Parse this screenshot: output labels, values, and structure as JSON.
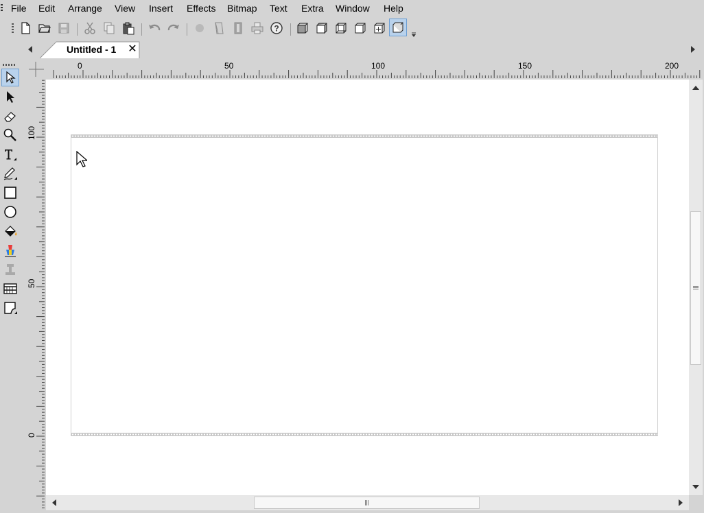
{
  "menu": {
    "items": [
      "File",
      "Edit",
      "Arrange",
      "View",
      "Insert",
      "Effects",
      "Bitmap",
      "Text",
      "Extra",
      "Window",
      "Help"
    ]
  },
  "toolbar": {
    "buttons": [
      {
        "icon": "new-document-icon",
        "enabled": true
      },
      {
        "icon": "open-folder-icon",
        "enabled": true
      },
      {
        "icon": "save-icon",
        "enabled": false
      },
      {
        "icon": "cut-icon",
        "enabled": false
      },
      {
        "icon": "copy-icon",
        "enabled": false
      },
      {
        "icon": "paste-icon",
        "enabled": true
      },
      {
        "icon": "undo-icon",
        "enabled": false
      },
      {
        "icon": "redo-icon",
        "enabled": false
      },
      {
        "icon": "circle-fill-icon",
        "enabled": false
      },
      {
        "icon": "page-curl-icon",
        "enabled": false
      },
      {
        "icon": "gradient-icon",
        "enabled": false
      },
      {
        "icon": "print-icon",
        "enabled": false
      },
      {
        "icon": "help-icon",
        "enabled": true
      },
      {
        "icon": "cube-front-icon",
        "enabled": true
      },
      {
        "icon": "cube-right-icon",
        "enabled": true
      },
      {
        "icon": "cube-wire-icon",
        "enabled": true
      },
      {
        "icon": "cube-left-icon",
        "enabled": true
      },
      {
        "icon": "cube-add-icon",
        "enabled": true
      },
      {
        "icon": "cube-3d-icon",
        "enabled": true,
        "active": true
      }
    ]
  },
  "tabs": [
    {
      "label": "Untitled - 1",
      "close_icon": "close-icon"
    }
  ],
  "rulers": {
    "horizontal_labels": [
      "0",
      "50",
      "100",
      "150",
      "200"
    ],
    "vertical_labels": [
      "100",
      "50",
      "0"
    ]
  },
  "tools": [
    {
      "icon": "selection-arrow-icon",
      "active": true
    },
    {
      "icon": "node-arrow-icon"
    },
    {
      "icon": "eraser-icon"
    },
    {
      "icon": "zoom-icon"
    },
    {
      "icon": "text-tool-icon"
    },
    {
      "icon": "pen-icon"
    },
    {
      "icon": "rectangle-icon"
    },
    {
      "icon": "ellipse-icon"
    },
    {
      "icon": "fill-bucket-icon"
    },
    {
      "icon": "color-fill-icon"
    },
    {
      "icon": "blend-icon",
      "enabled": false
    },
    {
      "icon": "table-icon"
    },
    {
      "icon": "curve-page-icon"
    }
  ],
  "colors": {
    "chrome": "#d4d4d4",
    "canvas": "#ffffff",
    "active_highlight": "#b9d2ec",
    "perforation": "#c9c9c9"
  }
}
